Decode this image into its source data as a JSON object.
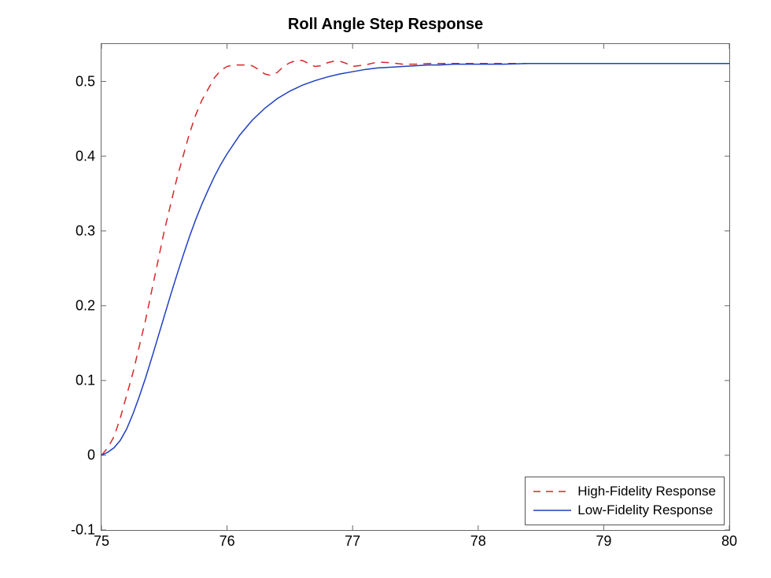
{
  "chart_data": {
    "type": "line",
    "title": "Roll Angle Step Response",
    "xlabel": "",
    "ylabel": "",
    "xlim": [
      75,
      80
    ],
    "ylim": [
      -0.1,
      0.55
    ],
    "xticks": [
      75,
      76,
      77,
      78,
      79,
      80
    ],
    "yticks": [
      -0.1,
      0,
      0.1,
      0.2,
      0.3,
      0.4,
      0.5
    ],
    "legend_position": "bottom-right",
    "series": [
      {
        "name": "High-Fidelity Response",
        "color": "#d62728",
        "style": "dashed",
        "x": [
          75.0,
          75.05,
          75.1,
          75.15,
          75.2,
          75.25,
          75.3,
          75.35,
          75.4,
          75.45,
          75.5,
          75.55,
          75.6,
          75.65,
          75.7,
          75.75,
          75.8,
          75.85,
          75.9,
          75.95,
          76.0,
          76.05,
          76.1,
          76.15,
          76.2,
          76.25,
          76.3,
          76.35,
          76.4,
          76.45,
          76.5,
          76.55,
          76.6,
          76.65,
          76.7,
          76.75,
          76.8,
          76.85,
          76.9,
          76.95,
          77.0,
          77.1,
          77.2,
          77.3,
          77.4,
          77.5,
          77.6,
          77.7,
          77.8,
          77.9,
          78.0,
          78.2,
          78.4,
          78.6,
          78.8,
          79.0,
          79.2,
          79.4,
          79.6,
          79.8,
          80.0
        ],
        "y": [
          0.0,
          0.01,
          0.025,
          0.05,
          0.08,
          0.11,
          0.145,
          0.18,
          0.22,
          0.26,
          0.3,
          0.335,
          0.37,
          0.4,
          0.43,
          0.455,
          0.475,
          0.49,
          0.505,
          0.515,
          0.52,
          0.522,
          0.522,
          0.522,
          0.521,
          0.516,
          0.51,
          0.508,
          0.512,
          0.52,
          0.525,
          0.528,
          0.528,
          0.524,
          0.52,
          0.521,
          0.525,
          0.527,
          0.527,
          0.524,
          0.52,
          0.522,
          0.526,
          0.525,
          0.523,
          0.523,
          0.524,
          0.524,
          0.524,
          0.524,
          0.524,
          0.524,
          0.524,
          0.524,
          0.524,
          0.524,
          0.524,
          0.524,
          0.524,
          0.524,
          0.524
        ]
      },
      {
        "name": "Low-Fidelity Response",
        "color": "#1f3fbf",
        "style": "solid",
        "x": [
          75.0,
          75.05,
          75.1,
          75.15,
          75.2,
          75.25,
          75.3,
          75.35,
          75.4,
          75.45,
          75.5,
          75.55,
          75.6,
          75.65,
          75.7,
          75.75,
          75.8,
          75.85,
          75.9,
          75.95,
          76.0,
          76.1,
          76.2,
          76.3,
          76.4,
          76.5,
          76.6,
          76.7,
          76.8,
          76.9,
          77.0,
          77.1,
          77.2,
          77.3,
          77.4,
          77.5,
          77.6,
          77.7,
          77.8,
          77.9,
          78.0,
          78.2,
          78.4,
          78.6,
          78.8,
          79.0,
          79.2,
          79.4,
          79.6,
          79.8,
          80.0
        ],
        "y": [
          0.0,
          0.004,
          0.01,
          0.02,
          0.035,
          0.055,
          0.078,
          0.103,
          0.13,
          0.158,
          0.186,
          0.214,
          0.241,
          0.267,
          0.292,
          0.315,
          0.336,
          0.355,
          0.373,
          0.389,
          0.403,
          0.428,
          0.448,
          0.464,
          0.477,
          0.487,
          0.495,
          0.501,
          0.506,
          0.51,
          0.513,
          0.516,
          0.518,
          0.519,
          0.52,
          0.521,
          0.522,
          0.522,
          0.523,
          0.523,
          0.523,
          0.523,
          0.524,
          0.524,
          0.524,
          0.524,
          0.524,
          0.524,
          0.524,
          0.524,
          0.524
        ]
      }
    ]
  }
}
